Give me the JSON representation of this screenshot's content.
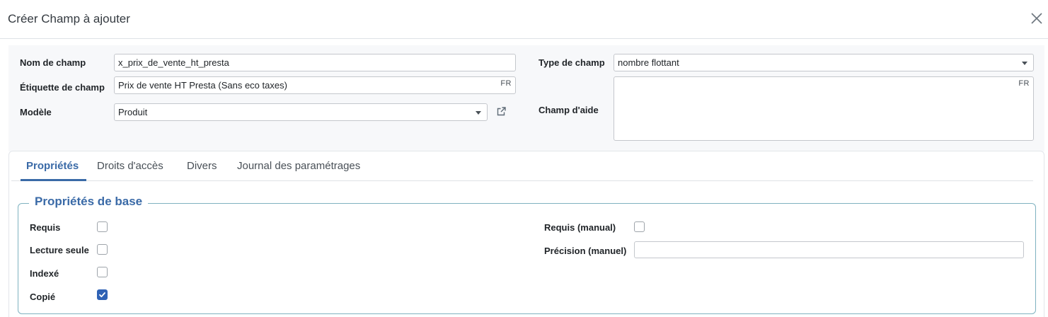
{
  "header": {
    "title": "Créer Champ à ajouter",
    "close_icon": "close-icon"
  },
  "form": {
    "field_name": {
      "label": "Nom de champ",
      "value": "x_prix_de_vente_ht_presta"
    },
    "field_label": {
      "label": "Étiquette de champ",
      "value": "Prix de vente HT Presta (Sans eco taxes)",
      "lang": "FR"
    },
    "model": {
      "label": "Modèle",
      "value": "Produit",
      "link_icon": "external-link-icon"
    },
    "field_type": {
      "label": "Type de champ",
      "value": "nombre flottant"
    },
    "help": {
      "label": "Champ d'aide",
      "value": "",
      "lang": "FR"
    }
  },
  "tabs": [
    {
      "label": "Propriétés",
      "active": true
    },
    {
      "label": "Droits d'accès",
      "active": false
    },
    {
      "label": "Divers",
      "active": false
    },
    {
      "label": "Journal des paramétrages",
      "active": false
    }
  ],
  "basic_props": {
    "title": "Propriétés de base",
    "required": {
      "label": "Requis",
      "checked": false
    },
    "readonly": {
      "label": "Lecture seule",
      "checked": false
    },
    "indexed": {
      "label": "Indexé",
      "checked": false
    },
    "copied": {
      "label": "Copié",
      "checked": true
    },
    "required_manual": {
      "label": "Requis (manual)",
      "checked": false
    },
    "precision_manual": {
      "label": "Précision (manuel)",
      "value": ""
    }
  },
  "colors": {
    "accent": "#3a6aa7",
    "checkbox_checked": "#2f62b5",
    "fieldset_border": "#7fb2c0"
  }
}
